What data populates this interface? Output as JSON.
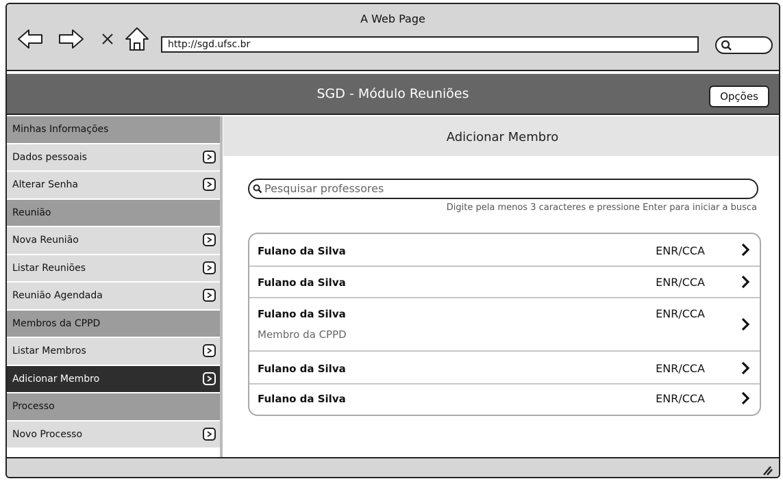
{
  "window": {
    "title": "A Web Page",
    "url": "http://sgd.ufsc.br"
  },
  "header": {
    "title": "SGD - Módulo Reuniões",
    "options_label": "Opções"
  },
  "sidebar": {
    "items": [
      {
        "label": "Minhas Informações",
        "type": "header"
      },
      {
        "label": "Dados pessoais",
        "type": "item"
      },
      {
        "label": "Alterar Senha",
        "type": "item"
      },
      {
        "label": "Reunião",
        "type": "header"
      },
      {
        "label": "Nova Reunião",
        "type": "item"
      },
      {
        "label": "Listar Reuniões",
        "type": "item"
      },
      {
        "label": "Reunião Agendada",
        "type": "item"
      },
      {
        "label": "Membros da CPPD",
        "type": "header"
      },
      {
        "label": "Listar Membros",
        "type": "item"
      },
      {
        "label": "Adicionar Membro",
        "type": "item",
        "active": true
      },
      {
        "label": "Processo",
        "type": "header"
      },
      {
        "label": "Novo Processo",
        "type": "item"
      }
    ]
  },
  "main": {
    "title": "Adicionar Membro",
    "search": {
      "placeholder": "Pesquisar professores",
      "hint": "Digite pela menos 3 caracteres e pressione Enter para iniciar a busca"
    },
    "results": [
      {
        "name": "Fulano da Silva",
        "dept": "ENR/CCA"
      },
      {
        "name": "Fulano da Silva",
        "dept": "ENR/CCA"
      },
      {
        "name": "Fulano da Silva",
        "dept": "ENR/CCA",
        "subtitle": "Membro da CPPD"
      },
      {
        "name": "Fulano da Silva",
        "dept": "ENR/CCA"
      },
      {
        "name": "Fulano da Silva",
        "dept": "ENR/CCA"
      }
    ]
  }
}
